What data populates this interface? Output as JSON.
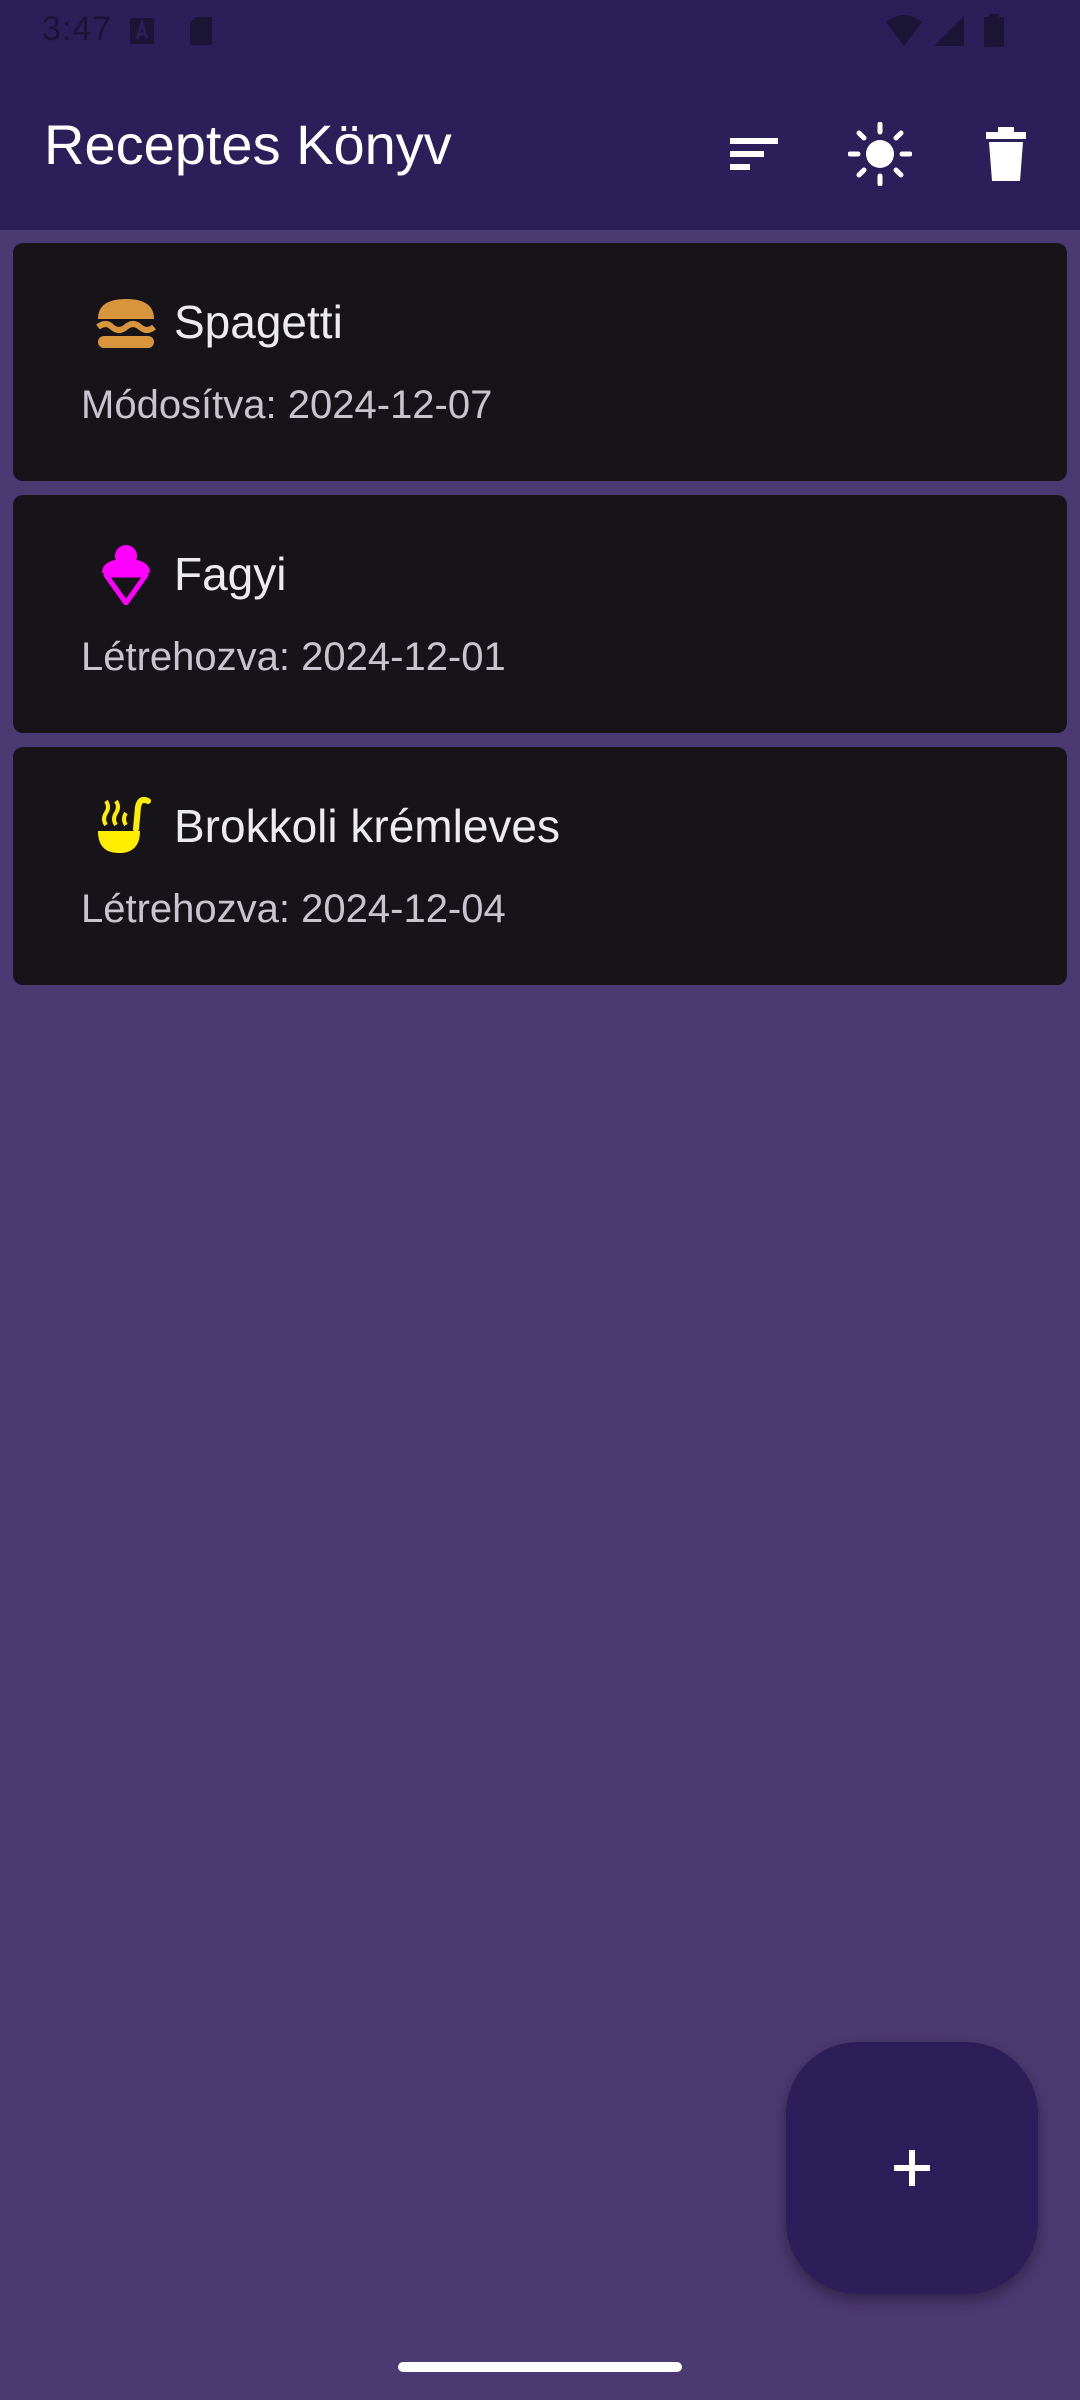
{
  "status_bar": {
    "time": "3:47",
    "icons": [
      "text-a-icon",
      "sd-card-icon",
      "wifi-icon",
      "cellular-signal-icon",
      "battery-icon"
    ]
  },
  "app_bar": {
    "title": "Receptes Könyv",
    "actions": [
      "sort-icon",
      "brightness-icon",
      "delete-icon"
    ]
  },
  "recipes": [
    {
      "icon": "hamburger-icon",
      "icon_color": "#d9953c",
      "title": "Spagetti",
      "subtitle": "Módosítva: 2024-12-07"
    },
    {
      "icon": "ice-cream-icon",
      "icon_color": "#ff00ff",
      "title": "Fagyi",
      "subtitle": "Létrehozva: 2024-12-01"
    },
    {
      "icon": "soup-ladle-icon",
      "icon_color": "#ffee00",
      "title": "Brokkoli krémleves",
      "subtitle": "Létrehozva: 2024-12-04"
    }
  ],
  "fab": {
    "icon": "plus-icon"
  },
  "colors": {
    "background": "#4b3971",
    "app_bar": "#2b1e59",
    "card": "#161419",
    "text_primary": "#ecebef",
    "text_secondary": "#c9c5cf"
  }
}
